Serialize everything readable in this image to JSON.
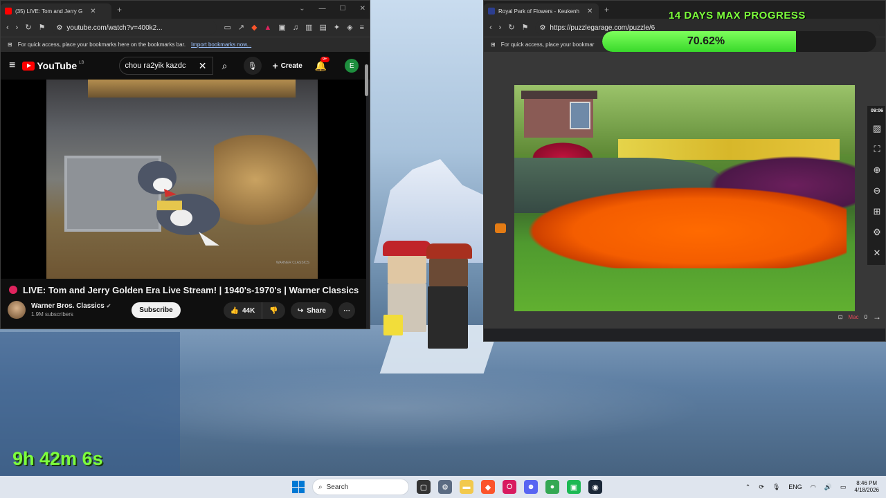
{
  "youtube_window": {
    "tab_title": "(35) LIVE: Tom and Jerry G",
    "url": "youtube.com/watch?v=400k2...",
    "bookmark_hint": "For quick access, place your bookmarks here on the bookmarks bar.",
    "bookmark_link": "Import bookmarks now...",
    "logo_text": "YouTube",
    "logo_sup": "LB",
    "search_value": "chou ra2yik kazdc",
    "create_label": "Create",
    "notif_count": "9+",
    "avatar_letter": "E",
    "video_watermark": "WARNER CLASSICS",
    "video_title": "LIVE: Tom and Jerry Golden Era Live Stream! | 1940's-1970's | Warner Classics",
    "channel_name": "Warner Bros. Classics",
    "subscribers": "1.9M subscribers",
    "subscribe_label": "Subscribe",
    "likes": "44K",
    "share_label": "Share"
  },
  "puzzle_window": {
    "tab_title": "Royal Park of Flowers - Keukenh",
    "url": "https://puzzlegarage.com/puzzle/6",
    "bookmark_hint": "For quick access, place your bookmar",
    "clock": "09:06",
    "footer_text": "Mac",
    "footer_count": "0"
  },
  "overlay": {
    "progress_title": "14 DAYS MAX PROGRESS",
    "progress_label": "70.62%",
    "progress_value": 0.7062,
    "stream_timer": "9h 42m 6s"
  },
  "taskbar": {
    "search_placeholder": "Search",
    "language": "ENG",
    "time": "8:46 PM",
    "date": "4/18/2026"
  },
  "colors": {
    "progress_green": "#7dff3c",
    "youtube_red": "#ff0000",
    "live_dot": "#e0245e"
  }
}
